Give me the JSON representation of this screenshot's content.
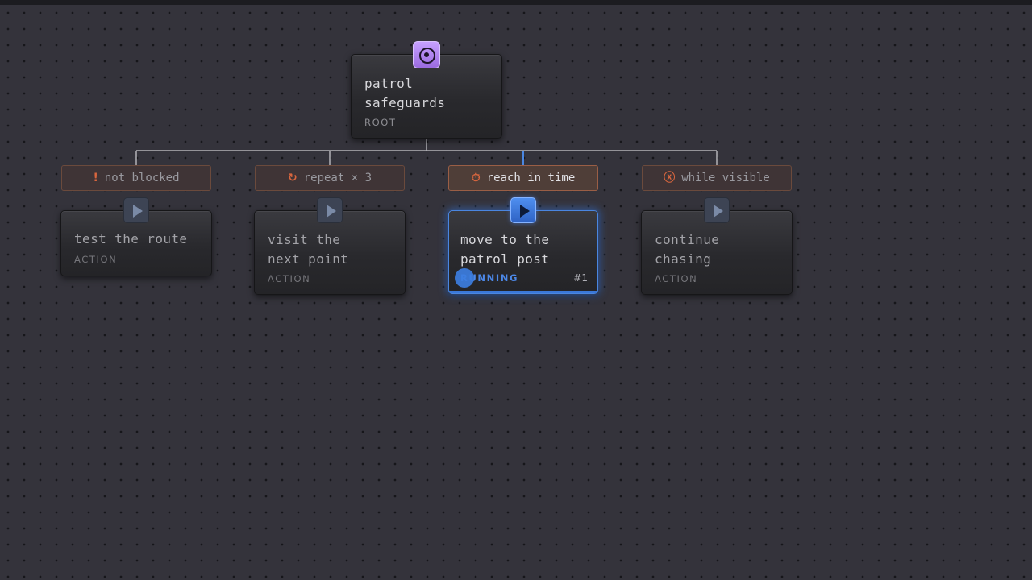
{
  "tree": {
    "root": {
      "title": "patrol safeguards",
      "type_label": "ROOT",
      "icon": "target-icon",
      "color": "#b088f0"
    },
    "children": [
      {
        "decorator": {
          "icon": "exclamation-icon",
          "glyph": "!",
          "label": "not blocked"
        },
        "title": "test the route",
        "type_label": "ACTION",
        "state": "idle"
      },
      {
        "decorator": {
          "icon": "repeat-icon",
          "glyph": "↻",
          "label": "repeat × 3"
        },
        "title": "visit the next point",
        "type_label": "ACTION",
        "state": "idle"
      },
      {
        "decorator": {
          "icon": "stopwatch-icon",
          "glyph": "⏱",
          "label": "reach in time"
        },
        "title": "move to the patrol post",
        "type_label": "RUNNING",
        "run_count": "#1",
        "state": "running"
      },
      {
        "decorator": {
          "icon": "circle-x-icon",
          "glyph": "ⓧ",
          "label": "while visible"
        },
        "title": "continue chasing",
        "type_label": "ACTION",
        "state": "idle"
      }
    ]
  },
  "colors": {
    "background": "#34333b",
    "running_accent": "#3c7de0",
    "decorator_accent": "#d9663e",
    "root_accent": "#b088f0"
  }
}
